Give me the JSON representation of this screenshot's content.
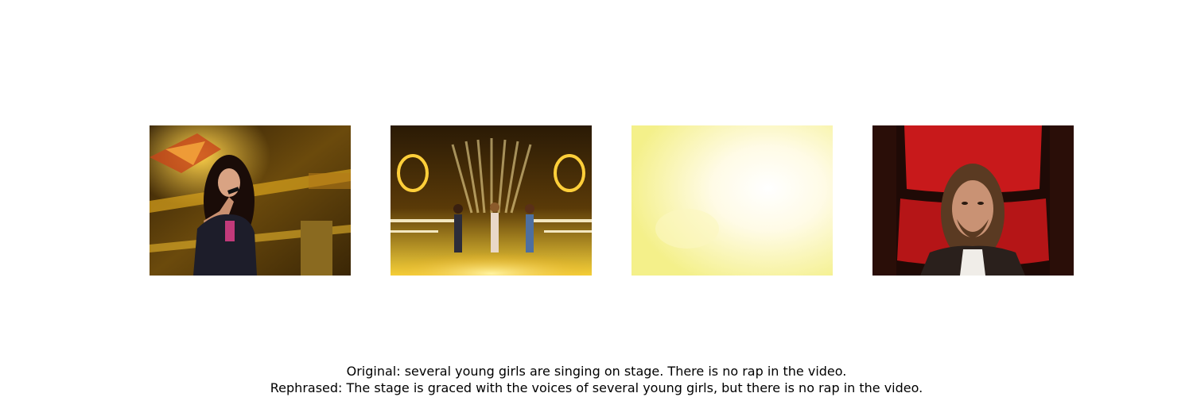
{
  "frames": [
    {
      "label": "singer-solo-frame"
    },
    {
      "label": "stage-trio-frame"
    },
    {
      "label": "light-flash-frame"
    },
    {
      "label": "coach-chair-frame"
    }
  ],
  "caption": {
    "original": "Original: several young girls are singing on stage. There is no rap in the video.",
    "rephrased": "Rephrased: The stage is graced with the voices of several young girls, but there is no rap in the video."
  }
}
